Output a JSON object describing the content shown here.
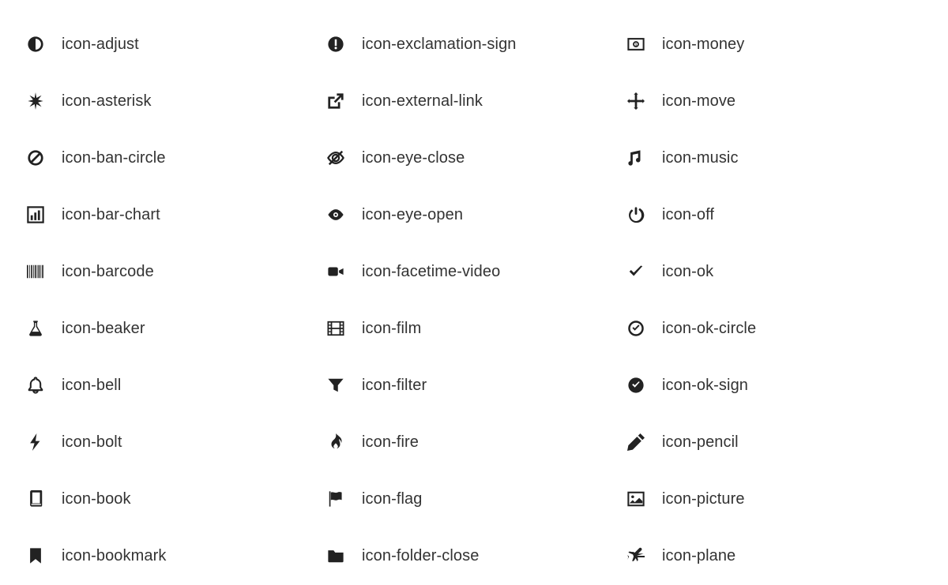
{
  "icons": {
    "col1": [
      {
        "name": "adjust-icon",
        "label": "icon-adjust"
      },
      {
        "name": "asterisk-icon",
        "label": "icon-asterisk"
      },
      {
        "name": "ban-circle-icon",
        "label": "icon-ban-circle"
      },
      {
        "name": "bar-chart-icon",
        "label": "icon-bar-chart"
      },
      {
        "name": "barcode-icon",
        "label": "icon-barcode"
      },
      {
        "name": "beaker-icon",
        "label": "icon-beaker"
      },
      {
        "name": "bell-icon",
        "label": "icon-bell"
      },
      {
        "name": "bolt-icon",
        "label": "icon-bolt"
      },
      {
        "name": "book-icon",
        "label": "icon-book"
      },
      {
        "name": "bookmark-icon",
        "label": "icon-bookmark"
      }
    ],
    "col2": [
      {
        "name": "exclamation-sign-icon",
        "label": "icon-exclamation-sign"
      },
      {
        "name": "external-link-icon",
        "label": "icon-external-link"
      },
      {
        "name": "eye-close-icon",
        "label": "icon-eye-close"
      },
      {
        "name": "eye-open-icon",
        "label": "icon-eye-open"
      },
      {
        "name": "facetime-video-icon",
        "label": "icon-facetime-video"
      },
      {
        "name": "film-icon",
        "label": "icon-film"
      },
      {
        "name": "filter-icon",
        "label": "icon-filter"
      },
      {
        "name": "fire-icon",
        "label": "icon-fire"
      },
      {
        "name": "flag-icon",
        "label": "icon-flag"
      },
      {
        "name": "folder-close-icon",
        "label": "icon-folder-close"
      }
    ],
    "col3": [
      {
        "name": "money-icon",
        "label": "icon-money"
      },
      {
        "name": "move-icon",
        "label": "icon-move"
      },
      {
        "name": "music-icon",
        "label": "icon-music"
      },
      {
        "name": "off-icon",
        "label": "icon-off"
      },
      {
        "name": "ok-icon",
        "label": "icon-ok"
      },
      {
        "name": "ok-circle-icon",
        "label": "icon-ok-circle"
      },
      {
        "name": "ok-sign-icon",
        "label": "icon-ok-sign"
      },
      {
        "name": "pencil-icon",
        "label": "icon-pencil"
      },
      {
        "name": "picture-icon",
        "label": "icon-picture"
      },
      {
        "name": "plane-icon",
        "label": "icon-plane"
      }
    ]
  }
}
